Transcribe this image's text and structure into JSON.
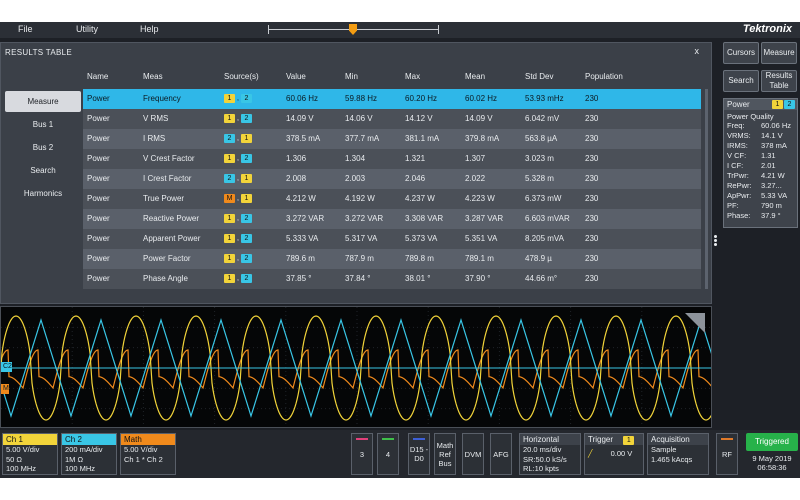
{
  "menu": {
    "file": "File",
    "utility": "Utility",
    "help": "Help",
    "brand": "Tektronix"
  },
  "results": {
    "title": "RESULTS TABLE",
    "close": "x",
    "tabs": [
      "Measure",
      "Bus 1",
      "Bus 2",
      "Search",
      "Harmonics"
    ],
    "active_tab": "Measure",
    "columns": [
      "Name",
      "Meas",
      "Source(s)",
      "Value",
      "Min",
      "Max",
      "Mean",
      "Std Dev",
      "Population"
    ],
    "rows": [
      {
        "name": "Power",
        "meas": "Frequency",
        "src": [
          "1",
          "2"
        ],
        "value": "60.06 Hz",
        "min": "59.88 Hz",
        "max": "60.20 Hz",
        "mean": "60.02 Hz",
        "std": "53.93 mHz",
        "pop": "230"
      },
      {
        "name": "Power",
        "meas": "V RMS",
        "src": [
          "1",
          "2"
        ],
        "value": "14.09 V",
        "min": "14.06 V",
        "max": "14.12 V",
        "mean": "14.09 V",
        "std": "6.042 mV",
        "pop": "230"
      },
      {
        "name": "Power",
        "meas": "I RMS",
        "src": [
          "2",
          "1"
        ],
        "value": "378.5 mA",
        "min": "377.7 mA",
        "max": "381.1 mA",
        "mean": "379.8 mA",
        "std": "563.8 µA",
        "pop": "230"
      },
      {
        "name": "Power",
        "meas": "V Crest Factor",
        "src": [
          "1",
          "2"
        ],
        "value": "1.306",
        "min": "1.304",
        "max": "1.321",
        "mean": "1.307",
        "std": "3.023 m",
        "pop": "230"
      },
      {
        "name": "Power",
        "meas": "I Crest Factor",
        "src": [
          "2",
          "1"
        ],
        "value": "2.008",
        "min": "2.003",
        "max": "2.046",
        "mean": "2.022",
        "std": "5.328 m",
        "pop": "230"
      },
      {
        "name": "Power",
        "meas": "True Power",
        "src": [
          "M",
          "1"
        ],
        "value": "4.212 W",
        "min": "4.192 W",
        "max": "4.237 W",
        "mean": "4.223 W",
        "std": "6.373 mW",
        "pop": "230"
      },
      {
        "name": "Power",
        "meas": "Reactive Power",
        "src": [
          "1",
          "2"
        ],
        "value": "3.272 VAR",
        "min": "3.272 VAR",
        "max": "3.308 VAR",
        "mean": "3.287 VAR",
        "std": "6.603 mVAR",
        "pop": "230"
      },
      {
        "name": "Power",
        "meas": "Apparent Power",
        "src": [
          "1",
          "2"
        ],
        "value": "5.333 VA",
        "min": "5.317 VA",
        "max": "5.373 VA",
        "mean": "5.351 VA",
        "std": "8.205 mVA",
        "pop": "230"
      },
      {
        "name": "Power",
        "meas": "Power Factor",
        "src": [
          "1",
          "2"
        ],
        "value": "789.6 m",
        "min": "787.9 m",
        "max": "789.8 m",
        "mean": "789.1 m",
        "std": "478.9 µ",
        "pop": "230"
      },
      {
        "name": "Power",
        "meas": "Phase Angle",
        "src": [
          "1",
          "2"
        ],
        "value": "37.85 °",
        "min": "37.84 °",
        "max": "38.01 °",
        "mean": "37.90 °",
        "std": "44.66 m°",
        "pop": "230"
      }
    ]
  },
  "right_panel": {
    "cursors": "Cursors",
    "measure": "Measure",
    "search": "Search",
    "results_table": "Results Table",
    "pq_head": "Power",
    "pq_title": "Power Quality",
    "pq_lines": [
      {
        "k": "Freq:",
        "v": "60.06 Hz"
      },
      {
        "k": "VRMS:",
        "v": "14.1 V"
      },
      {
        "k": "IRMS:",
        "v": "378 mA"
      },
      {
        "k": "V CF:",
        "v": "1.31"
      },
      {
        "k": "I CF:",
        "v": "2.01"
      },
      {
        "k": "TrPwr:",
        "v": "4.21 W"
      },
      {
        "k": "RePwr:",
        "v": "3.27..."
      },
      {
        "k": "ApPwr:",
        "v": "5.33 VA"
      },
      {
        "k": "PF:",
        "v": "790 m"
      },
      {
        "k": "Phase:",
        "v": "37.9 °"
      }
    ]
  },
  "scope": {
    "marker_c2": "C2",
    "marker_m": "M"
  },
  "bottom": {
    "ch1": {
      "head": "Ch 1",
      "l1": "5.00 V/div",
      "l2": "50 Ω",
      "l3": "100 MHz",
      "color": "#f2d43a"
    },
    "ch2": {
      "head": "Ch 2",
      "l1": "200 mA/div",
      "l2": "1M Ω",
      "l3": "100 MHz",
      "color": "#39c6e6"
    },
    "math": {
      "head": "Math",
      "l1": "5.00 V/div",
      "l2": "Ch 1 * Ch 2",
      "color": "#f08a1c"
    },
    "btn3": "3",
    "btn4": "4",
    "btn_d": "D15 -D0",
    "btn_mrb": "Math Ref Bus",
    "btn_dvm": "DVM",
    "btn_afg": "AFG",
    "horizontal": {
      "head": "Horizontal",
      "l1": "20.0 ms/div",
      "l2": "SR:50.0 kS/s",
      "l3": "RL:10 kpts"
    },
    "trigger": {
      "head": "Trigger",
      "level": "0.00 V"
    },
    "acquisition": {
      "head": "Acquisition",
      "l1": "Sample",
      "l2": "1.465 kAcqs"
    },
    "rf": "RF",
    "status": "Triggered",
    "date": "9 May 2019",
    "time": "06:58:36"
  }
}
